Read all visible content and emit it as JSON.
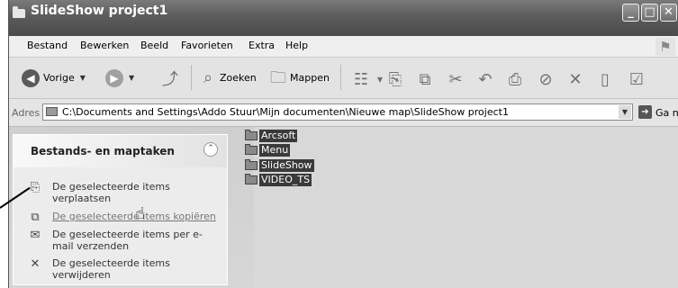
{
  "window": {
    "title": "SlideShow project1",
    "controls": {
      "minimize": "_",
      "maximize": "□",
      "close": "✕"
    }
  },
  "menu": {
    "items": [
      "Bestand",
      "Bewerken",
      "Beeld",
      "Favorieten",
      "Extra",
      "Help"
    ]
  },
  "toolbar": {
    "back_label": "Vorige",
    "search_label": "Zoeken",
    "folders_label": "Mappen"
  },
  "address": {
    "label": "Adres",
    "path": "C:\\Documents and Settings\\Addo Stuur\\Mijn documenten\\Nieuwe map\\SlideShow project1",
    "go_label": "Ga naar"
  },
  "taskpane": {
    "title": "Bestands- en maptaken",
    "tasks": [
      {
        "label": "De geselecteerde items verplaatsen",
        "icon": "move-icon"
      },
      {
        "label": "De geselecteerde items kopiëren",
        "icon": "copy-icon"
      },
      {
        "label": "De geselecteerde items per e-mail verzenden",
        "icon": "email-icon"
      },
      {
        "label": "De geselecteerde items verwijderen",
        "icon": "delete-icon"
      }
    ]
  },
  "files": [
    {
      "name": "Arcsoft",
      "selected": true
    },
    {
      "name": "Menu",
      "selected": true
    },
    {
      "name": "SlideShow",
      "selected": true
    },
    {
      "name": "VIDEO_TS",
      "selected": true
    }
  ]
}
